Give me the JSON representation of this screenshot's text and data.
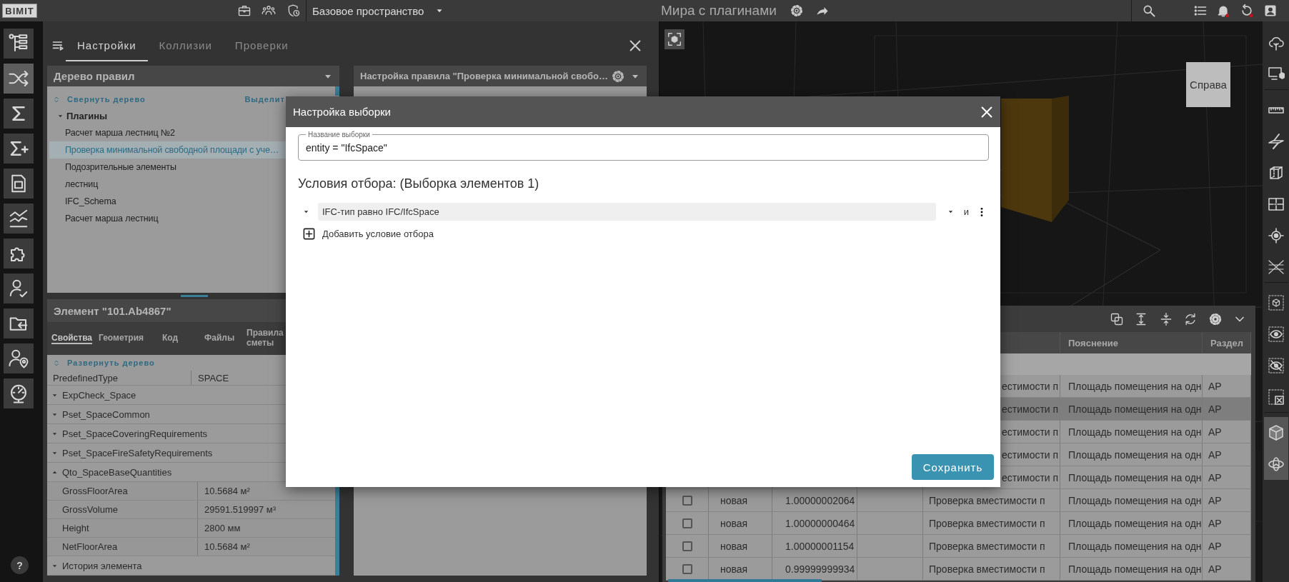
{
  "top_bar": {
    "logo": "BIMIT",
    "workspace": "Базовое пространство",
    "title": "Мира с плагинами"
  },
  "rail": {
    "items": [
      {
        "selected": false
      },
      {
        "selected": true
      },
      {
        "selected": false
      },
      {
        "selected": false
      },
      {
        "selected": false
      },
      {
        "selected": false
      },
      {
        "selected": false
      },
      {
        "selected": false
      },
      {
        "selected": false
      },
      {
        "selected": false
      },
      {
        "selected": false
      }
    ],
    "help": "?"
  },
  "panel": {
    "tabs": [
      {
        "label": "Настройки",
        "selected": true
      },
      {
        "label": "Коллизии",
        "selected": false
      },
      {
        "label": "Проверки",
        "selected": false
      }
    ]
  },
  "rule_tree": {
    "title": "Дерево правил",
    "collapse_link": "Свернуть дерево",
    "select_link": "Выделит",
    "items": [
      {
        "label": "Плагины",
        "expanded": true,
        "children": [
          {
            "label": "Расчет марша лестниц №2",
            "selected": false
          },
          {
            "label": "Проверка минимальной свободной площади с уче…",
            "selected": true
          },
          {
            "label": "Подозрительные элементы",
            "selected": false
          },
          {
            "label": "лестниц",
            "selected": false
          },
          {
            "label": "IFC_Schema",
            "selected": false
          },
          {
            "label": "Расчет марша лестниц",
            "selected": false
          }
        ]
      }
    ]
  },
  "rule_settings": {
    "title": "Настройка правила \"Проверка минимальной свобо…"
  },
  "element": {
    "title": "Элемент \"101.Ab4867\"",
    "tabs": [
      {
        "label": "Свойства",
        "selected": true
      },
      {
        "label": "Геометрия",
        "selected": false
      },
      {
        "label": "Код",
        "selected": false
      },
      {
        "label": "Файлы",
        "selected": false
      },
      {
        "label": "Правила сметы",
        "selected": false
      }
    ],
    "expand_link": "Развернуть дерево",
    "properties": [
      {
        "kind": "property",
        "name": "PredefinedType",
        "value": "SPACE"
      },
      {
        "kind": "group",
        "name": "ExpCheck_Space",
        "expanded": false
      },
      {
        "kind": "group",
        "name": "Pset_SpaceCommon",
        "expanded": false
      },
      {
        "kind": "group",
        "name": "Pset_SpaceCoveringRequirements",
        "expanded": false
      },
      {
        "kind": "group",
        "name": "Pset_SpaceFireSafetyRequirements",
        "expanded": false
      },
      {
        "kind": "group",
        "name": "Qto_SpaceBaseQuantities",
        "expanded": true,
        "children": [
          {
            "kind": "property",
            "name": "GrossFloorArea",
            "value": "10.5684 м²"
          },
          {
            "kind": "property",
            "name": "GrossVolume",
            "value": "29591.519997 м³"
          },
          {
            "kind": "property",
            "name": "Height",
            "value": "2800 мм"
          },
          {
            "kind": "property",
            "name": "NetFloorArea",
            "value": "10.5684 м²"
          }
        ]
      },
      {
        "kind": "group",
        "name": "История элемента",
        "expanded": false
      }
    ]
  },
  "viewer": {
    "view_cube": "Справа",
    "tools": [
      {
        "on": false
      },
      {
        "on": false
      },
      {
        "on": false
      },
      {
        "on": false
      },
      {
        "on": false
      },
      {
        "on": false
      },
      {
        "on": false
      },
      {
        "on": false
      },
      {
        "on": false
      },
      {
        "on": false
      },
      {
        "on": false
      },
      {
        "on": false
      },
      {
        "on": true
      },
      {
        "on": true
      }
    ]
  },
  "results": {
    "columns": [
      {
        "label": "Пояснение"
      },
      {
        "label": "Раздел"
      }
    ],
    "rows": [
      {
        "selected": false,
        "check": "естимости п",
        "explanation": "Площадь помещения на одн",
        "section": "АР"
      },
      {
        "selected": true,
        "check": "естимости п",
        "explanation": "Площадь помещения на одн",
        "section": "АР"
      },
      {
        "selected": false,
        "check": "естимости п",
        "explanation": "Площадь помещения на одн",
        "section": "АР"
      },
      {
        "selected": false,
        "check": "естимости п",
        "explanation": "Площадь помещения на одн",
        "section": "АР"
      },
      {
        "selected": false,
        "check": "естимости п",
        "explanation": "Площадь помещения на одн",
        "section": "АР"
      },
      {
        "selected": false,
        "checked": false,
        "status": "новая",
        "value": "1.00000002064",
        "check": "Проверка вместимости п",
        "explanation": "Площадь помещения на одн",
        "section": "АР"
      },
      {
        "selected": false,
        "checked": false,
        "status": "новая",
        "value": "1.00000000464",
        "check": "Проверка вместимости п",
        "explanation": "Площадь помещения на одн",
        "section": "АР"
      },
      {
        "selected": false,
        "checked": false,
        "status": "новая",
        "value": "1.00000001154",
        "check": "Проверка вместимости п",
        "explanation": "Площадь помещения на одн",
        "section": "АР"
      },
      {
        "selected": false,
        "checked": false,
        "status": "новая",
        "value": "0.99999999934",
        "check": "Проверка вместимости п",
        "explanation": "Площадь помещения на одн",
        "section": "АР"
      }
    ]
  },
  "dialog": {
    "title": "Настройка выборки",
    "name_field": {
      "label": "Название выборки",
      "value": "entity = \"IfcSpace\""
    },
    "conditions_heading": "Условия отбора: (Выборка элементов 1)",
    "conditions": [
      {
        "text": "IFC-тип равно IFC/IfcSpace",
        "operator": "и"
      }
    ],
    "add_condition": "Добавить условие отбора",
    "save_button": "Сохранить"
  }
}
